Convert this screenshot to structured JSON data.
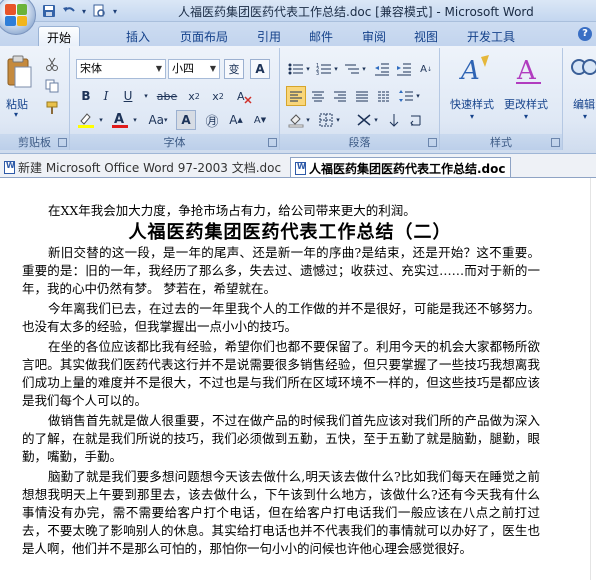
{
  "window": {
    "title": "人福医药集团医药代表工作总结.doc [兼容模式] - Microsoft Word"
  },
  "ribbon": {
    "tabs": [
      "开始",
      "插入",
      "页面布局",
      "引用",
      "邮件",
      "审阅",
      "视图",
      "开发工具"
    ],
    "active_tab": "开始",
    "clipboard": {
      "paste_label": "粘贴",
      "group_label": "剪贴板"
    },
    "font": {
      "name": "宋体",
      "size": "小四",
      "group_label": "字体"
    },
    "paragraph": {
      "group_label": "段落"
    },
    "styles": {
      "quick_label": "快速样式",
      "change_label": "更改样式",
      "group_label": "样式"
    },
    "editing": {
      "label": "编辑"
    }
  },
  "doc_tabs": [
    {
      "label": "新建 Microsoft Office Word 97-2003 文档.doc",
      "active": false
    },
    {
      "label": "人福医药集团医药代表工作总结.doc",
      "active": true
    }
  ],
  "document": {
    "intro": "在XX年我会加大力度，争抢市场占有力，给公司带来更大的利润。",
    "heading": "人福医药集团医药代表工作总结（二）",
    "paragraphs": [
      "新旧交替的这一段，是一年的尾声、还是新一年的序曲?是结束，还是开始？这不重要。 重要的是：旧的一年，我经历了那么多，失去过、遗憾过；收获过、充实过……而对于新的一年，我的心中仍然有梦。 梦若在，希望就在。",
      "今年离我们已去，在过去的一年里我个人的工作做的并不是很好，可能是我还不够努力。也没有太多的经验，但我掌握出一点小小的技巧。",
      "在坐的各位应该都比我有经验，希望你们也都不要保留了。利用今天的机会大家都畅所欲言吧。其实做我们医药代表这行并不是说需要很多销售经验，但只要掌握了一些技巧我想离我们成功上量的难度并不是很大，不过也是与我们所在区域环境不一样的，但这些技巧是都应该是我们每个人可以的。",
      "做销售首先就是做人很重要，不过在做产品的时候我们首先应该对我们所的产品做为深入的了解，在就是我们所说的技巧，我们必须做到五勤，五快，至于五勤了就是脑勤，腿勤，眼勤，嘴勤，手勤。",
      "脑勤了就是我们要多想问题想今天该去做什么,明天该去做什么?比如我们每天在睡觉之前想想我明天上午要到那里去，该去做什么，下午该到什么地方，该做什么?还有今天我有什么事情没有办完，需不需要给客户打个电话，但在给客户打电话我们一般应该在八点之前打过去，不要太晚了影响别人的休息。其实给打电话也并不代表我们的事情就可以办好了，医生也是人啊，他们并不是那么可怕的，那怕你一句小小的问候也许他心理会感觉很好。"
    ]
  }
}
